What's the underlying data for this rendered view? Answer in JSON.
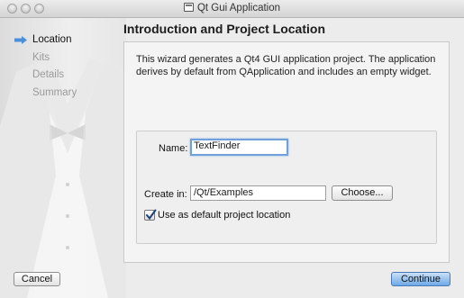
{
  "window": {
    "title": "Qt Gui Application"
  },
  "steps": [
    {
      "label": "Location",
      "active": true
    },
    {
      "label": "Kits",
      "active": false
    },
    {
      "label": "Details",
      "active": false
    },
    {
      "label": "Summary",
      "active": false
    }
  ],
  "page": {
    "heading": "Introduction and Project Location",
    "intro": "This wizard generates a Qt4 GUI application project. The application derives by default from QApplication and includes an empty widget."
  },
  "form": {
    "name_label": "Name:",
    "name_value": "TextFinder",
    "create_in_label": "Create in:",
    "create_in_value": "/Qt/Examples",
    "choose_button": "Choose...",
    "default_checkbox_label": "Use as default project location",
    "default_checked": true
  },
  "buttons": {
    "cancel": "Cancel",
    "continue": "Continue"
  },
  "colors": {
    "accent": "#6ea9e6",
    "active_arrow": "#4a8fd8"
  }
}
